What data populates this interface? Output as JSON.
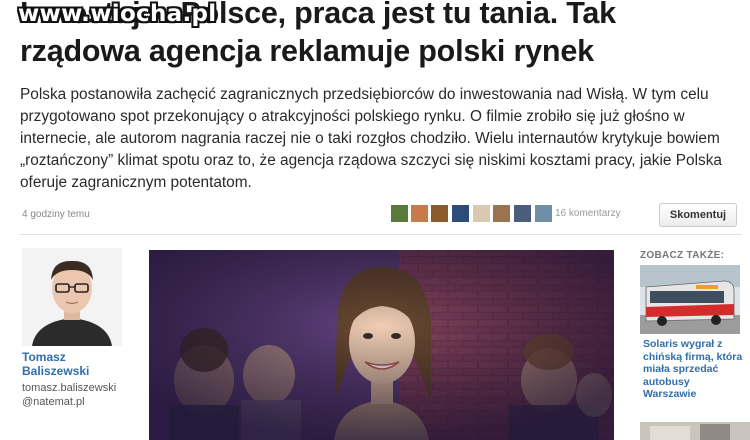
{
  "site": {
    "watermark": "www.wiocha.pl"
  },
  "article": {
    "title": "Inwestuj w Polsce, praca jest tu tania. Tak rządowa agencja reklamuje polski rynek",
    "lead": "Polska postanowiła zachęcić zagranicznych przedsiębiorców do inwestowania nad Wisłą. W tym celu przygotowano spot przekonujący o atrakcyjności polskiego rynku. O filmie zrobiło się już głośno w internecie, ale autorom nagrania raczej nie o taki rozgłos chodziło. Wielu internautów krytykuje bowiem „roztańczony” klimat spotu oraz to, że agencja rządowa szczyci się niskimi kosztami pracy, jakie Polska oferuje zagranicznym potentatom.",
    "published": "4 godziny temu",
    "comment_count": "16 komentarzy",
    "comment_button": "Skomentuj"
  },
  "author": {
    "name": "Tomasz Baliszewski",
    "handle": "tomasz.baliszewski @natemat.pl"
  },
  "sidebar": {
    "heading": "ZOBACZ TAKŻE:",
    "related_title": "Solaris wygrał z chińską firmą, która miała sprzedać autobusy Warszawie"
  },
  "colors": {
    "link": "#2f6faa",
    "headline": "#1a1a1a",
    "meta": "#888888"
  }
}
